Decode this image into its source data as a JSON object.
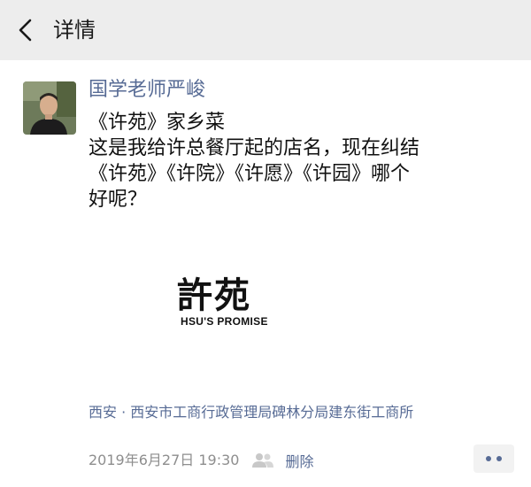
{
  "header": {
    "back_icon": "chevron-left-icon",
    "title": "详情"
  },
  "post": {
    "author": "国学老师严峻",
    "text_lines": [
      "《许苑》家乡菜",
      "这是我给许总餐厅起的店名，现在纠结",
      "《许苑》《许院》《许愿》《许园》哪个",
      "好呢？"
    ],
    "image": {
      "logo_text": "許苑",
      "logo_subtitle": "HSU'S PROMISE"
    },
    "location": "西安 · 西安市工商行政管理局碑林分局建东街工商所",
    "timestamp": "2019年6月27日 19:30",
    "visibility_icon": "friends-icon",
    "delete_label": "删除",
    "more_icon": "more-dots-icon"
  },
  "colors": {
    "link_blue": "#576b95",
    "navbar_bg": "#ededed",
    "meta_gray": "#8e8e8e"
  }
}
